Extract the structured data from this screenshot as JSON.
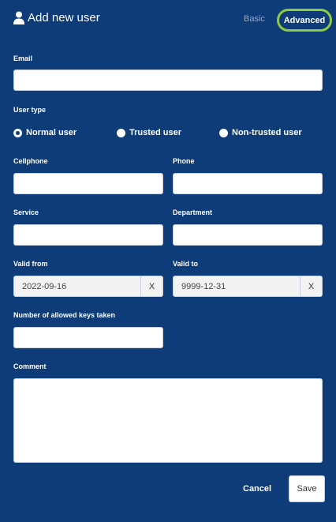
{
  "header": {
    "title": "Add new user",
    "icon": "user-icon",
    "mode_basic": "Basic",
    "mode_advanced": "Advanced",
    "active_mode": "Advanced",
    "highlight_color": "#8ecb3f"
  },
  "form": {
    "email": {
      "label": "Email",
      "value": ""
    },
    "user_type": {
      "label": "User type",
      "options": [
        "Normal user",
        "Trusted user",
        "Non-trusted user"
      ],
      "selected": "Normal user"
    },
    "cellphone": {
      "label": "Cellphone",
      "value": ""
    },
    "phone": {
      "label": "Phone",
      "value": ""
    },
    "service": {
      "label": "Service",
      "value": ""
    },
    "department": {
      "label": "Department",
      "value": ""
    },
    "valid_from": {
      "label": "Valid from",
      "value": "2022-09-16",
      "clear": "X"
    },
    "valid_to": {
      "label": "Valid to",
      "value": "9999-12-31",
      "clear": "X"
    },
    "allowed_keys": {
      "label": "Number of allowed keys taken",
      "value": ""
    },
    "comment": {
      "label": "Comment",
      "value": ""
    }
  },
  "actions": {
    "cancel": "Cancel",
    "save": "Save"
  },
  "colors": {
    "background": "#0d3c78",
    "accent": "#8ecb3f"
  }
}
